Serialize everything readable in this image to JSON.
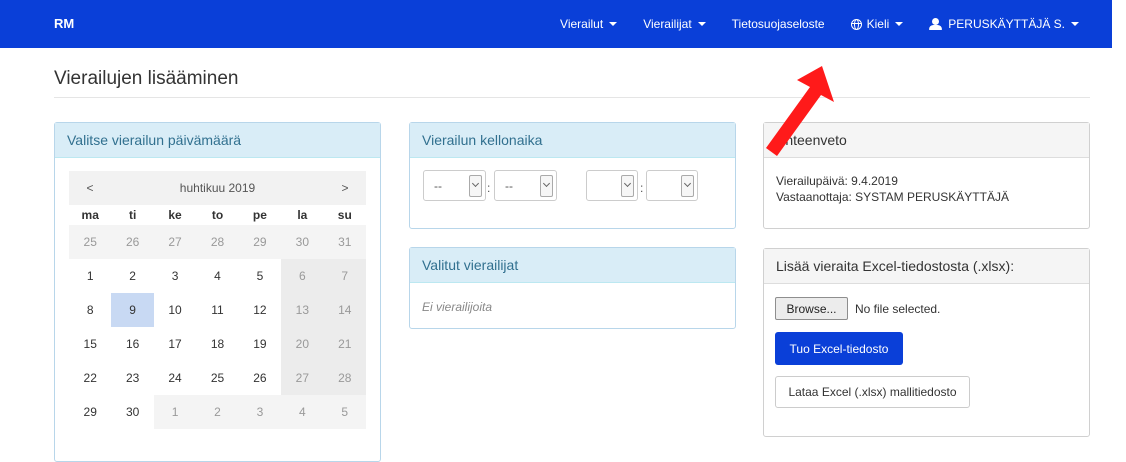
{
  "navbar": {
    "brand": "RM",
    "items": [
      {
        "label": "Vierailut",
        "dropdown": true
      },
      {
        "label": "Vierailijat",
        "dropdown": true
      },
      {
        "label": "Tietosuojaseloste",
        "dropdown": false
      },
      {
        "label": "Kieli",
        "dropdown": true,
        "icon": "globe-icon"
      },
      {
        "label": "PERUSKÄYTTÄJÄ S.",
        "dropdown": true,
        "icon": "user-icon"
      }
    ]
  },
  "page": {
    "title": "Vierailujen lisääminen"
  },
  "date_panel": {
    "heading": "Valitse vierailun päivämäärä",
    "calendar": {
      "prev": "<",
      "month": "huhtikuu 2019",
      "next": ">",
      "weekdays": [
        "ma",
        "ti",
        "ke",
        "to",
        "pe",
        "la",
        "su"
      ],
      "weeks": [
        [
          "25",
          "26",
          "27",
          "28",
          "29",
          "30",
          "31"
        ],
        [
          "1",
          "2",
          "3",
          "4",
          "5",
          "6",
          "7"
        ],
        [
          "8",
          "9",
          "10",
          "11",
          "12",
          "13",
          "14"
        ],
        [
          "15",
          "16",
          "17",
          "18",
          "19",
          "20",
          "21"
        ],
        [
          "22",
          "23",
          "24",
          "25",
          "26",
          "27",
          "28"
        ],
        [
          "29",
          "30",
          "1",
          "2",
          "3",
          "4",
          "5"
        ]
      ],
      "selected_day": "9"
    }
  },
  "time_panel": {
    "heading": "Vierailun kellonaika",
    "start_hour": "--",
    "start_minute": "--",
    "end_hour": "",
    "end_minute": "",
    "separator": ":"
  },
  "visitors_panel": {
    "heading": "Valitut vierailijat",
    "empty_text": "Ei vierailijoita"
  },
  "summary_panel": {
    "heading": "Yhteenveto",
    "visit_date": "Vierailupäivä: 9.4.2019",
    "host": "Vastaanottaja: SYSTAM PERUSKÄYTTÄJÄ"
  },
  "excel_panel": {
    "heading": "Lisää vieraita Excel-tiedostosta (.xlsx):",
    "browse_label": "Browse...",
    "file_status": "No file selected.",
    "import_button": "Tuo Excel-tiedosto",
    "template_button": "Lataa Excel (.xlsx) mallitiedosto"
  },
  "colors": {
    "navbar": "#0a3fd8",
    "panel_heading_info": "#d9edf7",
    "primary_button": "#0a3fd8",
    "annotation_arrow": "#ff1a1a"
  }
}
